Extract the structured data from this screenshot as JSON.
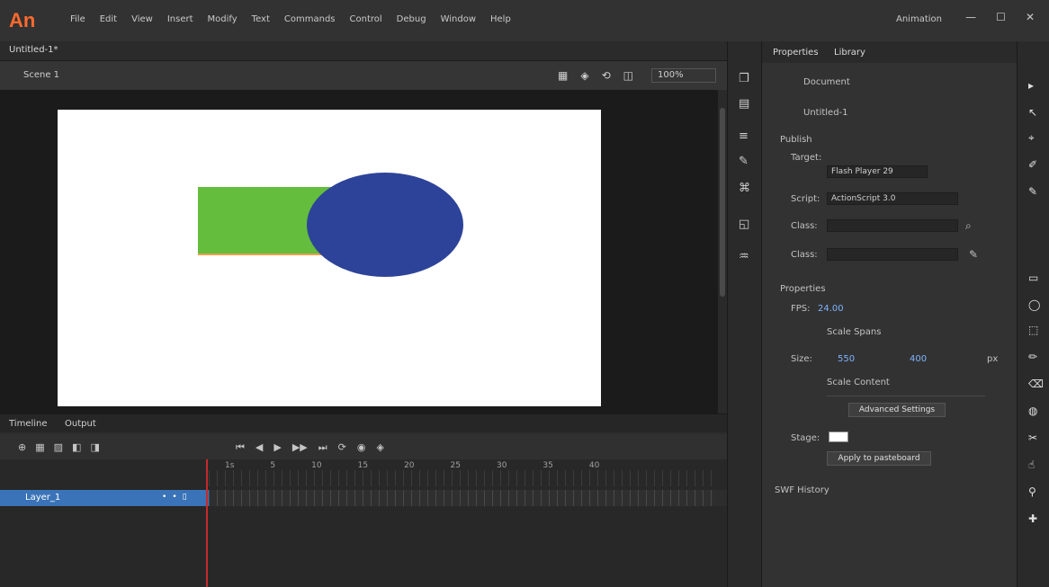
{
  "app": {
    "logo": "An",
    "menu": [
      "File",
      "Edit",
      "View",
      "Insert",
      "Modify",
      "Text",
      "Commands",
      "Control",
      "Debug",
      "Window",
      "Help"
    ],
    "workspace": "Animation",
    "win": [
      "—",
      "☐",
      "✕"
    ]
  },
  "document": {
    "tab": "Untitled-1*",
    "scene": "Scene 1",
    "zoom": "100%"
  },
  "stage": {
    "tools": [
      "▦",
      "◈",
      "⟲",
      "◫"
    ],
    "colors": {
      "rectangle": "#64bd3c",
      "rect_stroke": "#e9a14b",
      "ellipse": "#2d4399",
      "stage_bg": "#ffffff"
    }
  },
  "timeline": {
    "tabs": [
      "Timeline",
      "Output"
    ],
    "controls": [
      "⊕",
      "▦",
      "▨",
      "◧",
      "◨"
    ],
    "playback": [
      "⏮",
      "◀",
      "▶",
      "▶▶",
      "⏭",
      "⟳",
      "◉",
      "◈"
    ],
    "frame_numbers": [
      "1s",
      "5",
      "10",
      "15",
      "20",
      "25",
      "30",
      "35",
      "40"
    ],
    "layer": {
      "name": "Layer_1",
      "toggles": [
        "•",
        "•",
        "▯"
      ]
    }
  },
  "panel_icons": [
    "❐",
    "▤",
    "≡",
    "✎",
    "⌘",
    "◱",
    "♒"
  ],
  "properties": {
    "tabs": [
      "Properties",
      "Library"
    ],
    "document_label": "Document",
    "file_name": "Untitled-1",
    "publish_label": "Publish",
    "target_label": "Target:",
    "target_value": "Flash Player 29",
    "script_label": "Script:",
    "script_value": "ActionScript 3.0",
    "class_label": "Class:",
    "properties_section": "Properties",
    "fps_label": "FPS:",
    "fps_value": "24.00",
    "scale_spans": "Scale Spans",
    "size_label": "Size:",
    "width_value": "550",
    "height_value": "400",
    "px": "px",
    "scale_content": "Scale Content",
    "advanced_settings": "Advanced Settings",
    "stage_label": "Stage:",
    "stage_color": "#ffffff",
    "apply_to_pasteboard": "Apply to pasteboard",
    "swf_history": "SWF History"
  },
  "tools": [
    "▸",
    "↖",
    "⌖",
    "✐",
    "✎",
    "▭",
    "◯",
    "⬚",
    "✏",
    "⌫",
    "◍",
    "✂",
    "☝",
    "⚲",
    "✚"
  ]
}
